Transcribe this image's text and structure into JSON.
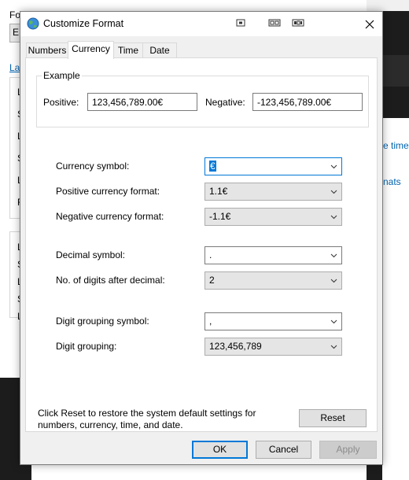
{
  "background": {
    "left_label_top": "Fo",
    "left_field_text": "E",
    "left_link": "La",
    "left_letters_1": [
      "L",
      "S",
      "L",
      "S",
      "L",
      "F"
    ],
    "left_letters_2": [
      "L",
      "S",
      "L",
      "S",
      "L"
    ],
    "right_link_1": "e time",
    "right_link_2": "nats"
  },
  "dialog": {
    "title": "Customize Format",
    "icon": "globe-icon"
  },
  "tabs": [
    {
      "label": "Numbers"
    },
    {
      "label": "Currency"
    },
    {
      "label": "Time"
    },
    {
      "label": "Date"
    }
  ],
  "example": {
    "legend": "Example",
    "positive_label": "Positive:",
    "positive_value": "123,456,789.00€",
    "negative_label": "Negative:",
    "negative_value": "-123,456,789.00€"
  },
  "settings": {
    "currency_symbol": {
      "label": "Currency symbol:",
      "value": "€"
    },
    "positive_format": {
      "label": "Positive currency format:",
      "value": "1.1€"
    },
    "negative_format": {
      "label": "Negative currency format:",
      "value": "-1.1€"
    },
    "decimal_symbol": {
      "label": "Decimal symbol:",
      "value": "."
    },
    "digits_after_decimal": {
      "label": "No. of digits after decimal:",
      "value": "2"
    },
    "grouping_symbol": {
      "label": "Digit grouping symbol:",
      "value": ","
    },
    "digit_grouping": {
      "label": "Digit grouping:",
      "value": "123,456,789"
    }
  },
  "footer": {
    "info": "Click Reset to restore the system default settings for numbers, currency, time, and date.",
    "reset_label": "Reset",
    "ok_label": "OK",
    "cancel_label": "Cancel",
    "apply_label": "Apply"
  },
  "colors": {
    "accent": "#0078d7",
    "dialog_bg": "#f0f0f0"
  }
}
